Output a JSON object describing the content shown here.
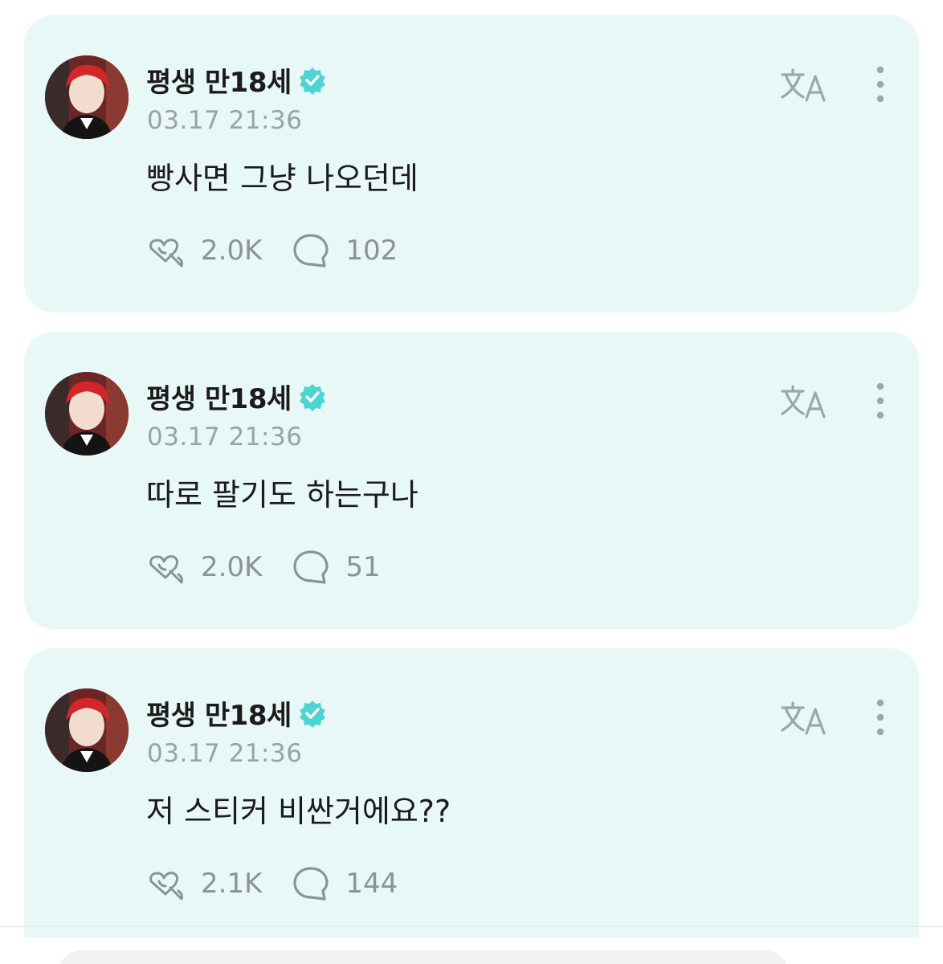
{
  "posts": [
    {
      "author": "평생 만18세",
      "time": "03.17 21:36",
      "text": "빵사면 그냥 나오던데",
      "likes": "2.0K",
      "comments": "102"
    },
    {
      "author": "평생 만18세",
      "time": "03.17 21:36",
      "text": "따로 팔기도 하는구나",
      "likes": "2.0K",
      "comments": "51"
    },
    {
      "author": "평생 만18세",
      "time": "03.17 21:36",
      "text": "저 스티커 비싼거에요??",
      "likes": "2.1K",
      "comments": "144"
    }
  ],
  "icons": {
    "verified": "verified-badge-icon",
    "translate": "translate-icon",
    "more": "more-vertical-icon",
    "like": "heart-sparkle-icon",
    "comment": "comment-bubble-icon"
  },
  "colors": {
    "card_bg": "#e8f8f6",
    "verified": "#4fd4d4",
    "muted": "#9aa3a3"
  }
}
